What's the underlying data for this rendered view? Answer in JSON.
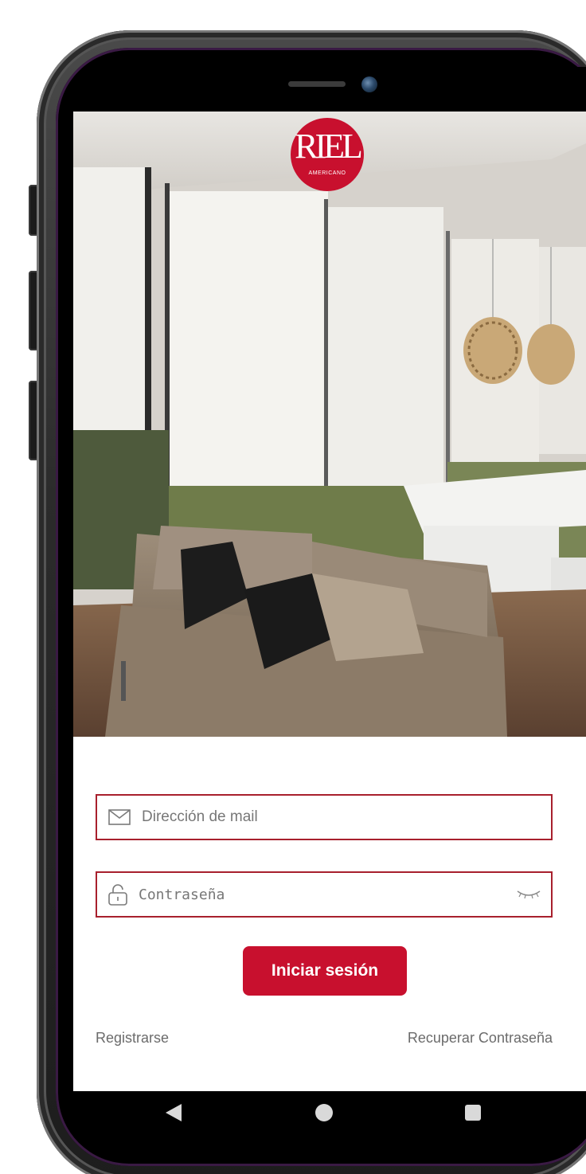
{
  "brand": {
    "logo_main": "RIEL",
    "logo_sub": "AMERICANO",
    "color": "#c8102e"
  },
  "login_form": {
    "email": {
      "placeholder": "Dirección de mail",
      "icon": "mail-icon"
    },
    "password": {
      "placeholder": "Contraseña",
      "icon": "lock-icon",
      "toggle_icon": "eye-closed-icon"
    },
    "submit_label": "Iniciar sesión",
    "register_label": "Registrarse",
    "recover_label": "Recuperar Contraseña",
    "accent_color": "#a8202d"
  },
  "system_nav": {
    "back_icon": "back-triangle-icon",
    "home_icon": "home-circle-icon",
    "recents_icon": "recents-square-icon"
  }
}
